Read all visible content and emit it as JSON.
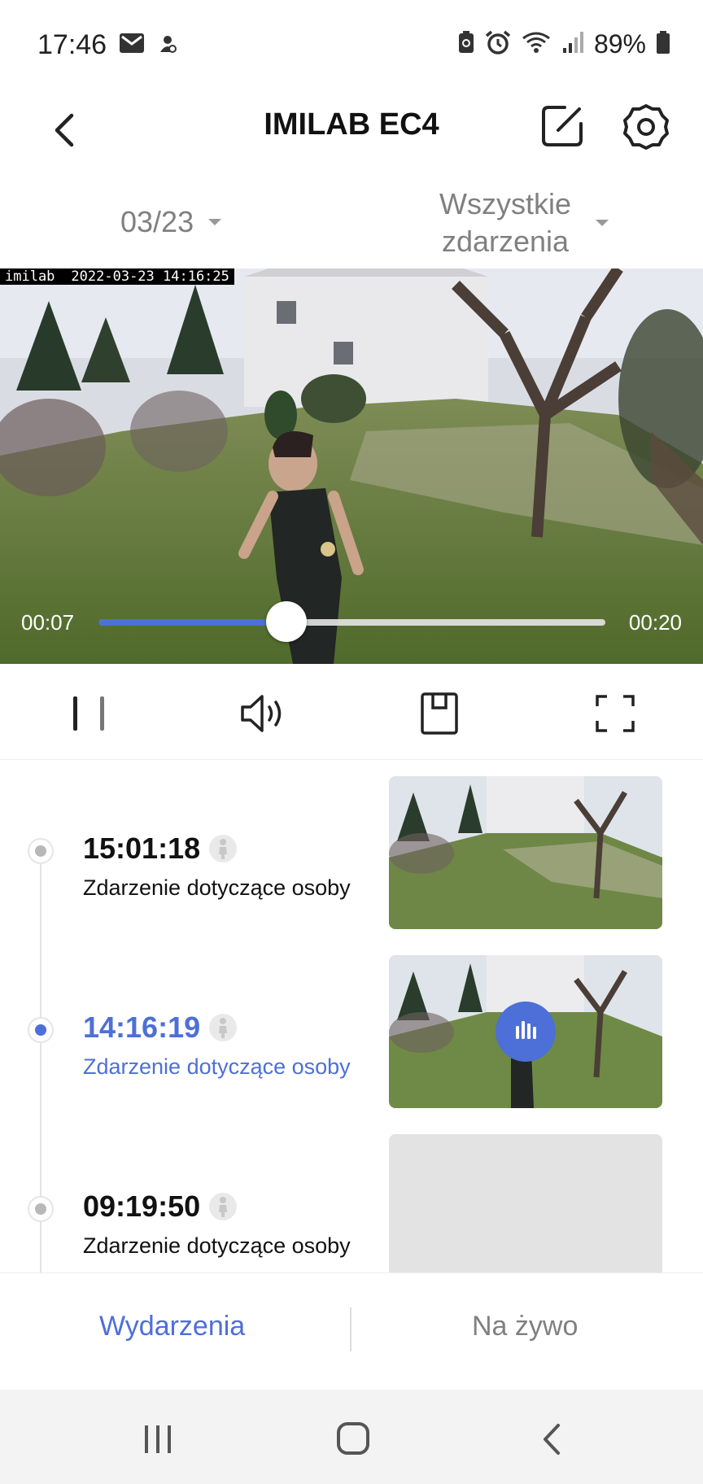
{
  "status_bar": {
    "time": "17:46",
    "battery": "89%",
    "left_icons": [
      "mail-icon",
      "vpn-icon"
    ],
    "right_icons": [
      "battery-saver-icon",
      "alarm-icon",
      "wifi-icon",
      "signal-icon",
      "battery-icon"
    ]
  },
  "header": {
    "title": "IMILAB EC4",
    "icons": [
      "back-icon",
      "edit-icon",
      "gear-icon"
    ]
  },
  "filters": {
    "date": "03/23",
    "event_type_line1": "Wszystkie",
    "event_type_line2": "zdarzenia"
  },
  "video": {
    "watermark_brand": "imilab",
    "watermark_datetime": "2022-03-23 14:16:25",
    "current_time": "00:07",
    "total_time": "00:20",
    "progress": 0.37
  },
  "controls": {
    "icons": [
      "pause-icon",
      "volume-icon",
      "save-icon",
      "fullscreen-icon"
    ]
  },
  "events": [
    {
      "time": "15:01:18",
      "description": "Zdarzenie dotyczące osoby",
      "active": false,
      "has_thumbnail": true
    },
    {
      "time": "14:16:19",
      "description": "Zdarzenie dotyczące osoby",
      "active": true,
      "has_thumbnail": true
    },
    {
      "time": "09:19:50",
      "description": "Zdarzenie dotyczące osoby",
      "active": false,
      "has_thumbnail": false
    }
  ],
  "tabs": {
    "events_label": "Wydarzenia",
    "live_label": "Na żywo",
    "active": "events"
  },
  "nav_bar": {
    "icons": [
      "recent-apps-icon",
      "home-icon",
      "back-nav-icon"
    ]
  },
  "colors": {
    "accent": "#4d6fd8",
    "muted_text": "#808080",
    "navbar_bg": "#f3f3f3"
  }
}
